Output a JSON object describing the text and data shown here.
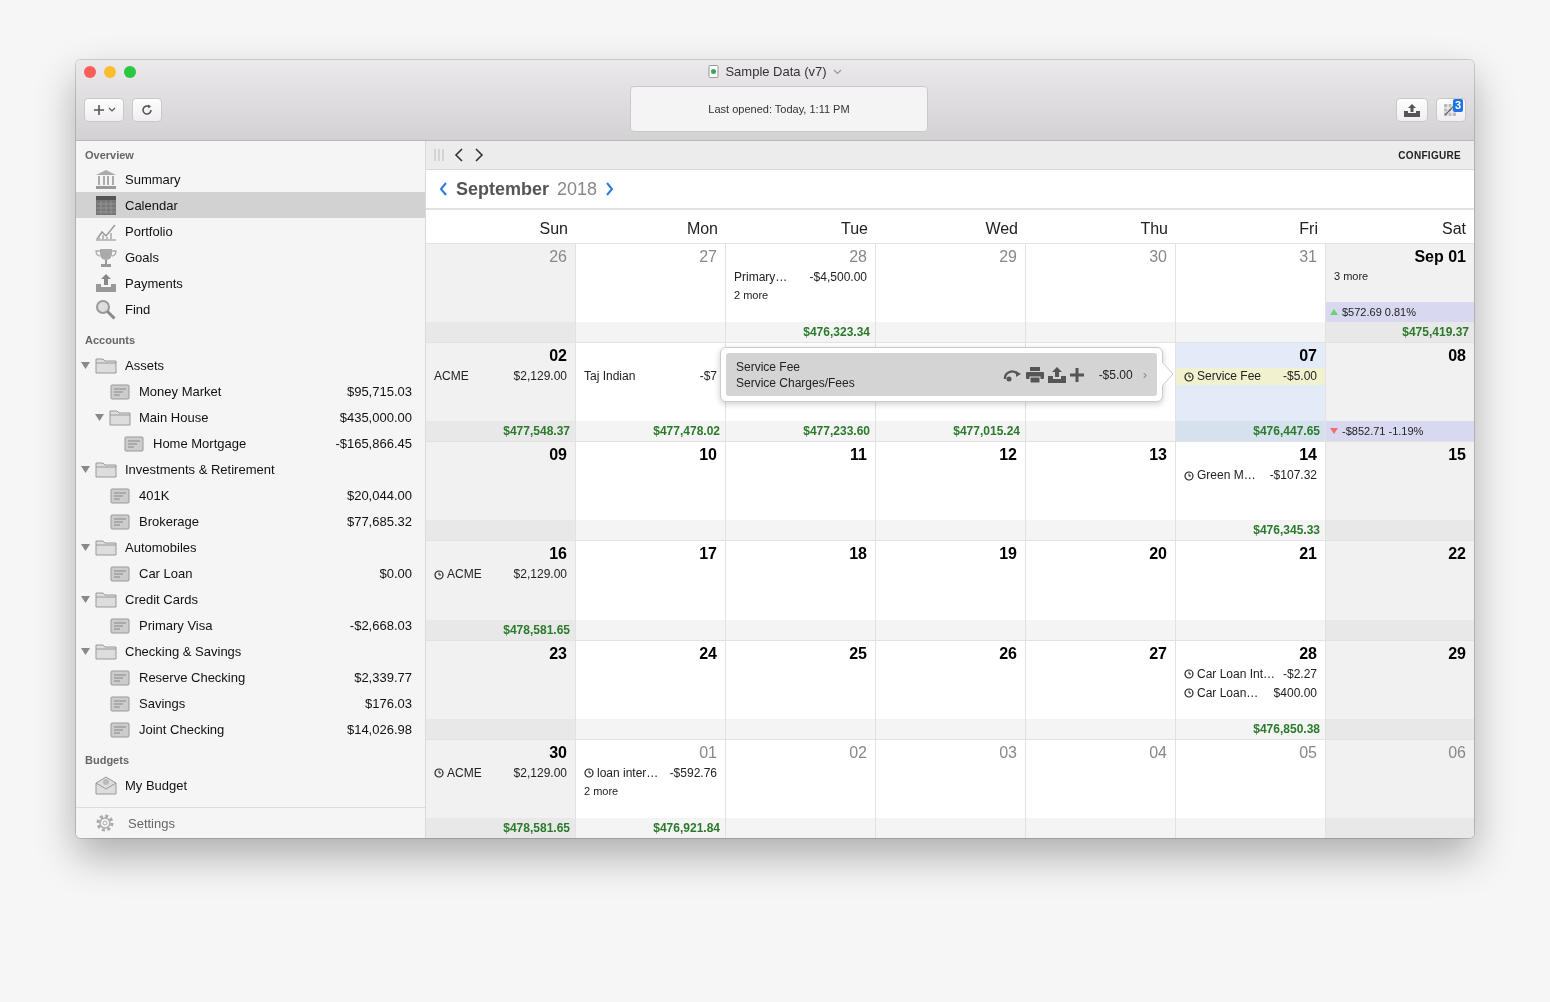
{
  "window": {
    "title": "Sample Data (v7)",
    "status": "Last opened: Today, 1:11 PM",
    "badge": "3"
  },
  "sidebar": {
    "sections": [
      {
        "header": "Overview",
        "items": [
          {
            "label": "Summary",
            "selected": false
          },
          {
            "label": "Calendar",
            "selected": true
          },
          {
            "label": "Portfolio",
            "selected": false
          },
          {
            "label": "Goals",
            "selected": false
          },
          {
            "label": "Payments",
            "selected": false
          },
          {
            "label": "Find",
            "selected": false
          }
        ]
      },
      {
        "header": "Accounts",
        "items": [
          {
            "label": "Assets",
            "selected": false,
            "expanded": true,
            "children": [
              {
                "label": "Money Market",
                "amount": "$95,715.03",
                "selected": false
              },
              {
                "label": "Main House",
                "amount": "$435,000.00",
                "selected": false,
                "expanded": true,
                "children": [
                  {
                    "label": "Home Mortgage",
                    "amount": "-$165,866.45",
                    "selected": false
                  }
                ]
              }
            ]
          },
          {
            "label": "Investments & Retirement",
            "selected": false,
            "expanded": true,
            "children": [
              {
                "label": "401K",
                "amount": "$20,044.00",
                "selected": false
              },
              {
                "label": "Brokerage",
                "amount": "$77,685.32",
                "selected": false
              }
            ]
          },
          {
            "label": "Automobiles",
            "selected": false,
            "expanded": true,
            "children": [
              {
                "label": "Car Loan",
                "amount": "$0.00",
                "selected": false
              }
            ]
          },
          {
            "label": "Credit Cards",
            "selected": false,
            "expanded": true,
            "children": [
              {
                "label": "Primary Visa",
                "amount": "-$2,668.03",
                "selected": false
              }
            ]
          },
          {
            "label": "Checking & Savings",
            "selected": false,
            "expanded": true,
            "children": [
              {
                "label": "Reserve Checking",
                "amount": "$2,339.77",
                "selected": false
              },
              {
                "label": "Savings",
                "amount": "$176.03",
                "selected": false
              },
              {
                "label": "Joint Checking",
                "amount": "$14,026.98",
                "selected": false
              }
            ]
          }
        ]
      },
      {
        "header": "Budgets",
        "items": [
          {
            "label": "My Budget",
            "selected": false
          }
        ]
      }
    ],
    "footer": "Settings"
  },
  "toolbar": {
    "configure": "CONFIGURE"
  },
  "calendar": {
    "month": "September",
    "year": "2018",
    "weekdays": [
      "Sun",
      "Mon",
      "Tue",
      "Wed",
      "Thu",
      "Fri",
      "Sat"
    ],
    "weeks": [
      [
        {
          "number": "26",
          "other_month": true,
          "selected": false
        },
        {
          "number": "27",
          "other_month": true,
          "selected": false
        },
        {
          "number": "28",
          "other_month": true,
          "selected": false,
          "entries": [
            {
              "name": "Primary…",
              "amount": "-$4,500.00",
              "scheduled": false,
              "selected": false
            }
          ],
          "more": "2 more",
          "total": "$476,323.34"
        },
        {
          "number": "29",
          "other_month": true,
          "selected": false
        },
        {
          "number": "30",
          "other_month": true,
          "selected": false
        },
        {
          "number": "31",
          "other_month": true,
          "selected": false
        },
        {
          "number": "Sep 01",
          "other_month": false,
          "selected": false,
          "more": "3 more",
          "change": {
            "rising": true,
            "amount": "$572.69",
            "percent": "0.81%"
          },
          "total": "$475,419.37"
        }
      ],
      [
        {
          "number": "02",
          "other_month": false,
          "selected": false,
          "entries": [
            {
              "name": "ACME",
              "amount": "$2,129.00",
              "scheduled": false,
              "selected": false
            }
          ],
          "total": "$477,548.37"
        },
        {
          "selected": false,
          "entries": [
            {
              "name": "Taj Indian",
              "amount": "-$7",
              "scheduled": false,
              "selected": false
            }
          ],
          "total": "$477,478.02"
        },
        {
          "selected": false,
          "total": "$477,233.60"
        },
        {
          "selected": false,
          "total": "$477,015.24"
        },
        {
          "selected": false
        },
        {
          "number": "07",
          "other_month": false,
          "selected": true,
          "entries": [
            {
              "name": "Service Fee",
              "amount": "-$5.00",
              "scheduled": true,
              "selected": true
            }
          ],
          "total": "$476,447.65"
        },
        {
          "number": "08",
          "other_month": false,
          "selected": false,
          "change": {
            "rising": false,
            "amount": "-$852.71",
            "percent": "-1.19%"
          }
        }
      ],
      [
        {
          "number": "09",
          "other_month": false,
          "selected": false
        },
        {
          "number": "10",
          "other_month": false,
          "selected": false
        },
        {
          "number": "11",
          "other_month": false,
          "selected": false
        },
        {
          "number": "12",
          "other_month": false,
          "selected": false
        },
        {
          "number": "13",
          "other_month": false,
          "selected": false
        },
        {
          "number": "14",
          "other_month": false,
          "selected": false,
          "entries": [
            {
              "name": "Green M…",
              "amount": "-$107.32",
              "scheduled": true,
              "selected": false
            }
          ],
          "total": "$476,345.33"
        },
        {
          "number": "15",
          "other_month": false,
          "selected": false
        }
      ],
      [
        {
          "number": "16",
          "other_month": false,
          "selected": false,
          "entries": [
            {
              "name": "ACME",
              "amount": "$2,129.00",
              "scheduled": true,
              "selected": false
            }
          ],
          "total": "$478,581.65"
        },
        {
          "number": "17",
          "other_month": false,
          "selected": false
        },
        {
          "number": "18",
          "other_month": false,
          "selected": false
        },
        {
          "number": "19",
          "other_month": false,
          "selected": false
        },
        {
          "number": "20",
          "other_month": false,
          "selected": false
        },
        {
          "number": "21",
          "other_month": false,
          "selected": false
        },
        {
          "number": "22",
          "other_month": false,
          "selected": false
        }
      ],
      [
        {
          "number": "23",
          "other_month": false,
          "selected": false
        },
        {
          "number": "24",
          "other_month": false,
          "selected": false
        },
        {
          "number": "25",
          "other_month": false,
          "selected": false
        },
        {
          "number": "26",
          "other_month": false,
          "selected": false
        },
        {
          "number": "27",
          "other_month": false,
          "selected": false
        },
        {
          "number": "28",
          "other_month": false,
          "selected": false,
          "entries": [
            {
              "name": "Car Loan Int…",
              "amount": "-$2.27",
              "scheduled": true,
              "selected": false
            },
            {
              "name": "Car Loan…",
              "amount": "$400.00",
              "scheduled": true,
              "selected": false
            }
          ],
          "total": "$476,850.38"
        },
        {
          "number": "29",
          "other_month": false,
          "selected": false
        }
      ],
      [
        {
          "number": "30",
          "other_month": false,
          "selected": false,
          "entries": [
            {
              "name": "ACME",
              "amount": "$2,129.00",
              "scheduled": true,
              "selected": false
            }
          ],
          "total": "$478,581.65"
        },
        {
          "number": "01",
          "other_month": true,
          "selected": false,
          "entries": [
            {
              "name": "loan inter…",
              "amount": "-$592.76",
              "scheduled": true,
              "selected": false
            }
          ],
          "more": "2 more",
          "total": "$476,921.84"
        },
        {
          "number": "02",
          "other_month": true,
          "selected": false
        },
        {
          "number": "03",
          "other_month": true,
          "selected": false
        },
        {
          "number": "04",
          "other_month": true,
          "selected": false
        },
        {
          "number": "05",
          "other_month": true,
          "selected": false
        },
        {
          "number": "06",
          "other_month": true,
          "selected": false
        }
      ]
    ]
  },
  "popover": {
    "title": "Service Fee",
    "category": "Service Charges/Fees",
    "amount": "-$5.00",
    "chevron": "›"
  }
}
